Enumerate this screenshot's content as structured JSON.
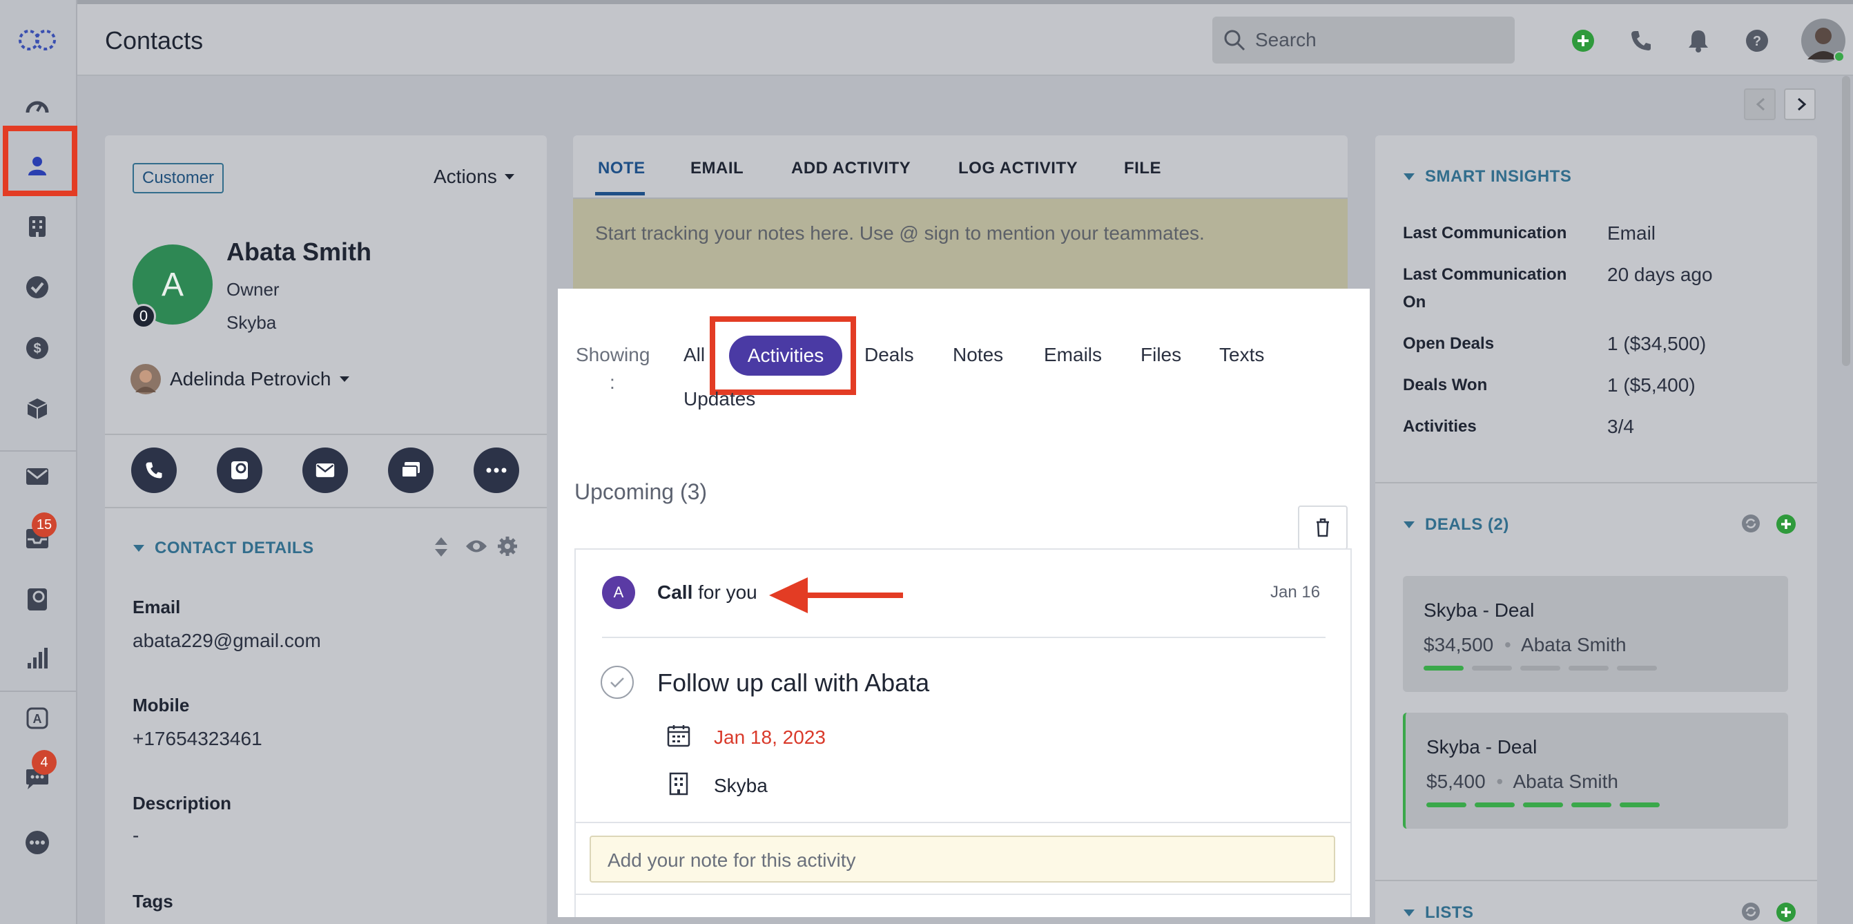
{
  "header": {
    "title": "Contacts",
    "search_placeholder": "Search"
  },
  "nav": {
    "badges": {
      "inbox": "15",
      "chat": "4"
    }
  },
  "contact": {
    "badge": "Customer",
    "actions_label": "Actions",
    "avatar_initial": "A",
    "avatar_count": "0",
    "name": "Abata Smith",
    "role": "Owner",
    "company": "Skyba",
    "owner_name": "Adelinda Petrovich",
    "details_header": "CONTACT DETAILS",
    "fields": {
      "email_label": "Email",
      "email_value": "abata229@gmail.com",
      "mobile_label": "Mobile",
      "mobile_value": "+17654323461",
      "description_label": "Description",
      "description_value": "-",
      "tags_label": "Tags"
    }
  },
  "compose": {
    "tabs": [
      "NOTE",
      "EMAIL",
      "ADD ACTIVITY",
      "LOG ACTIVITY",
      "FILE"
    ],
    "note_placeholder": "Start tracking your notes here. Use @ sign to mention your teammates."
  },
  "activity": {
    "showing_label": "Showing",
    "showing_colon": ":",
    "filters": [
      "All",
      "Activities",
      "Deals",
      "Notes",
      "Emails",
      "Files",
      "Texts",
      "Updates"
    ],
    "active_filter": "Activities",
    "upcoming_label": "Upcoming (3)",
    "item": {
      "avatar": "A",
      "type": "Call",
      "for": "for you",
      "date": "Jan 16",
      "title": "Follow up call with Abata",
      "due": "Jan 18, 2023",
      "company": "Skyba",
      "note_placeholder": "Add your note for this activity"
    }
  },
  "insights": {
    "header": "SMART INSIGHTS",
    "rows": [
      {
        "label": "Last Communication",
        "value": "Email"
      },
      {
        "label": "Last Communication On",
        "value": "20 days ago"
      },
      {
        "label": "Open Deals",
        "value": "1 ($34,500)"
      },
      {
        "label": "Deals Won",
        "value": "1 ($5,400)"
      },
      {
        "label": "Activities",
        "value": "3/4"
      }
    ]
  },
  "deals": {
    "header": "DEALS (2)",
    "items": [
      {
        "title": "Skyba - Deal",
        "amount": "$34,500",
        "contact": "Abata Smith",
        "stage_progress": 0.2
      },
      {
        "title": "Skyba - Deal",
        "amount": "$5,400",
        "contact": "Abata Smith",
        "stage_progress": 1.0
      }
    ]
  },
  "lists": {
    "header": "LISTS"
  },
  "colors": {
    "accent": "#4a3aa4",
    "highlight": "#e33c24",
    "success": "#3aa84a",
    "due_date": "#d93a2b"
  }
}
